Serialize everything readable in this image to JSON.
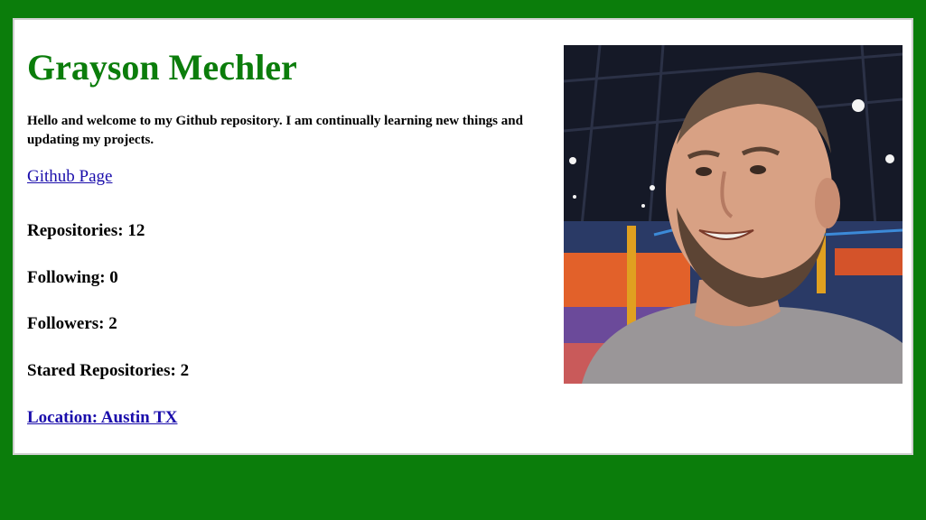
{
  "profile": {
    "name": "Grayson Mechler",
    "bio": "Hello and welcome to my Github repository. I am continually learning new things and updating my projects.",
    "github_link": "Github Page",
    "stats": {
      "repositories": "Repositories: 12",
      "following": "Following: 0",
      "followers": "Followers: 2",
      "stared": "Stared Repositories: 2"
    },
    "location": "Location: Austin TX"
  },
  "colors": {
    "background": "#0b7d0b",
    "name": "#0b7d0b",
    "link": "#1a0dab"
  }
}
